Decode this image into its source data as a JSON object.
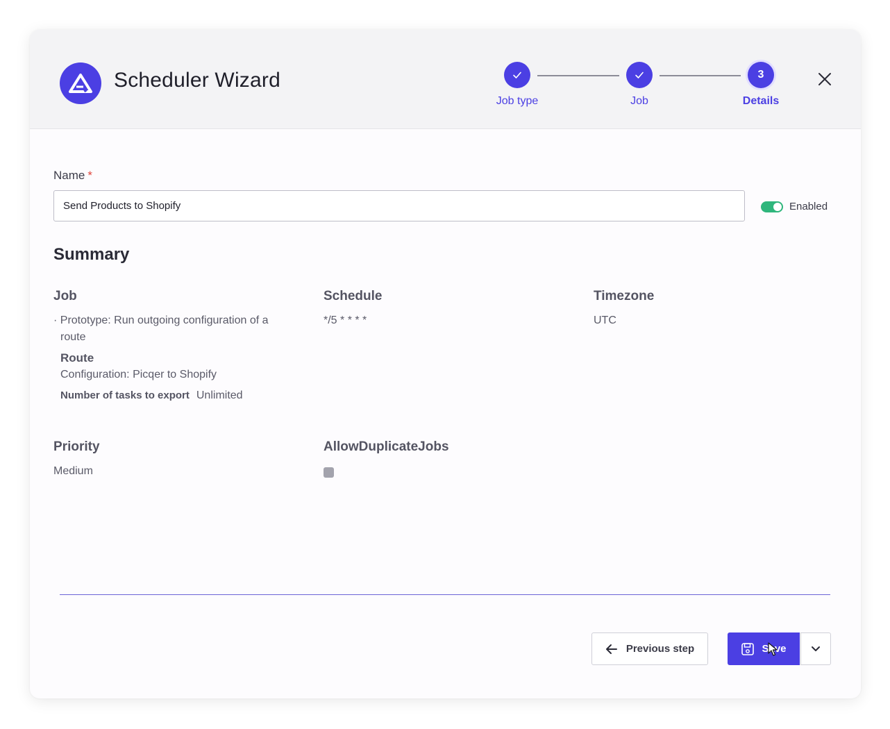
{
  "header": {
    "title": "Scheduler Wizard",
    "steps": [
      {
        "label": "Job type",
        "status": "completed",
        "icon": "check-icon"
      },
      {
        "label": "Job",
        "status": "completed",
        "icon": "check-icon"
      },
      {
        "label": "Details",
        "status": "active",
        "number": "3"
      }
    ],
    "close_icon": "close-icon"
  },
  "form": {
    "name_label": "Name",
    "required_marker": "*",
    "name_value": "Send Products to Shopify",
    "enabled_label": "Enabled",
    "enabled": true
  },
  "summary": {
    "title": "Summary",
    "job": {
      "heading": "Job",
      "item": "· Prototype: Run outgoing configuration of a route",
      "route_heading": "Route",
      "route_value": "Configuration: Picqer to Shopify",
      "tasks_label": "Number of tasks to export",
      "tasks_value": "Unlimited"
    },
    "schedule": {
      "heading": "Schedule",
      "value": "*/5 * * * *"
    },
    "timezone": {
      "heading": "Timezone",
      "value": "UTC"
    },
    "priority": {
      "heading": "Priority",
      "value": "Medium"
    },
    "allow_duplicate_jobs": {
      "heading": "AllowDuplicateJobs",
      "checked": false
    }
  },
  "footer": {
    "previous_label": "Previous step",
    "save_label": "Save"
  },
  "colors": {
    "accent": "#4b3fe3",
    "toggle_on": "#2fb67c",
    "required": "#e0463d"
  }
}
